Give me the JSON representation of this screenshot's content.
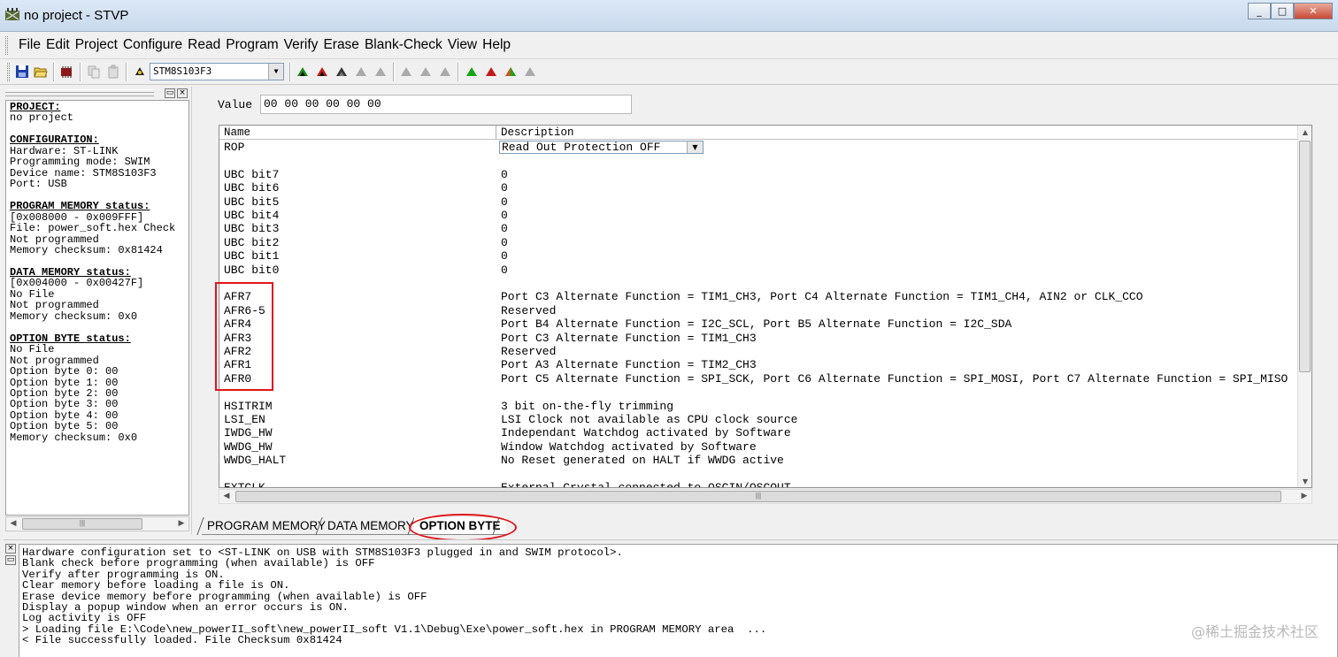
{
  "window": {
    "title": "no project - STVP",
    "min": "_",
    "max": "□",
    "close": "✕"
  },
  "menu": [
    {
      "label": "File"
    },
    {
      "label": "Edit"
    },
    {
      "label": "Project"
    },
    {
      "label": "Configure"
    },
    {
      "label": "Read"
    },
    {
      "label": "Program"
    },
    {
      "label": "Verify"
    },
    {
      "label": "Erase"
    },
    {
      "label": "Blank-Check"
    },
    {
      "label": "View"
    },
    {
      "label": "Help"
    }
  ],
  "toolbar": {
    "device": "STM8S103F3"
  },
  "left_panel": {
    "project_heading": "PROJECT:",
    "project_value": "no project",
    "config_heading": "CONFIGURATION:",
    "config_lines": [
      "Hardware: ST-LINK",
      "Programming mode: SWIM",
      "Device name: STM8S103F3",
      "Port: USB"
    ],
    "program_heading": "PROGRAM MEMORY status:",
    "program_lines": [
      "[0x008000 - 0x009FFF]",
      "File: power_soft.hex Check",
      "Not programmed",
      "Memory checksum: 0x81424"
    ],
    "data_heading": "DATA MEMORY status:",
    "data_lines": [
      "[0x004000 - 0x00427F]",
      "No File",
      "Not programmed",
      "Memory checksum: 0x0"
    ],
    "option_heading": "OPTION BYTE status:",
    "option_lines": [
      "No File",
      "Not programmed",
      "Option byte 0: 00",
      "Option byte 1: 00",
      "Option byte 2: 00",
      "Option byte 3: 00",
      "Option byte 4: 00",
      "Option byte 5: 00",
      "Memory checksum: 0x0"
    ]
  },
  "value_field": {
    "label": "Value",
    "value": "00 00 00 00 00 00"
  },
  "grid": {
    "col_name": "Name",
    "col_desc": "Description",
    "rop": {
      "name": "ROP",
      "desc": "Read Out Protection OFF"
    },
    "rows": [
      {
        "name": "UBC bit7",
        "desc": "0"
      },
      {
        "name": "UBC bit6",
        "desc": "0"
      },
      {
        "name": "UBC bit5",
        "desc": "0"
      },
      {
        "name": "UBC bit4",
        "desc": "0"
      },
      {
        "name": "UBC bit3",
        "desc": "0"
      },
      {
        "name": "UBC bit2",
        "desc": "0"
      },
      {
        "name": "UBC bit1",
        "desc": "0"
      },
      {
        "name": "UBC bit0",
        "desc": "0"
      },
      {
        "name": "",
        "desc": ""
      },
      {
        "name": "AFR7",
        "desc": "Port C3 Alternate Function = TIM1_CH3, Port C4 Alternate Function = TIM1_CH4, AIN2 or CLK_CCO"
      },
      {
        "name": "AFR6-5",
        "desc": "Reserved"
      },
      {
        "name": "AFR4",
        "desc": "Port B4 Alternate Function = I2C_SCL, Port B5 Alternate Function = I2C_SDA"
      },
      {
        "name": "AFR3",
        "desc": "Port C3 Alternate Function = TIM1_CH3"
      },
      {
        "name": "AFR2",
        "desc": "Reserved"
      },
      {
        "name": "AFR1",
        "desc": "Port A3 Alternate Function = TIM2_CH3"
      },
      {
        "name": "AFR0",
        "desc": "Port C5 Alternate Function = SPI_SCK, Port C6 Alternate Function = SPI_MOSI, Port C7 Alternate Function = SPI_MISO"
      },
      {
        "name": "",
        "desc": ""
      },
      {
        "name": "HSITRIM",
        "desc": "3 bit on-the-fly trimming"
      },
      {
        "name": "LSI_EN",
        "desc": "LSI Clock not available as CPU clock source"
      },
      {
        "name": "IWDG_HW",
        "desc": "Independant Watchdog activated by Software"
      },
      {
        "name": "WWDG_HW",
        "desc": "Window Watchdog activated by Software"
      },
      {
        "name": "WWDG_HALT",
        "desc": "No Reset generated on HALT if WWDG active"
      },
      {
        "name": "",
        "desc": ""
      },
      {
        "name": "EXTCLK",
        "desc": "External Crystal connected to OSCIN/OSCOUT"
      }
    ]
  },
  "tabs": [
    {
      "label": "PROGRAM MEMORY"
    },
    {
      "label": "DATA MEMORY"
    },
    {
      "label": "OPTION BYTE"
    }
  ],
  "log": [
    "Hardware configuration set to <ST-LINK on USB with STM8S103F3 plugged in and SWIM protocol>.",
    "Blank check before programming (when available) is OFF",
    "Verify after programming is ON.",
    "Clear memory before loading a file is ON.",
    "Erase device memory before programming (when available) is OFF",
    "Display a popup window when an error occurs is ON.",
    "Log activity is OFF",
    "> Loading file E:\\Code\\new_powerII_soft\\new_powerII_soft V1.1\\Debug\\Exe\\power_soft.hex in PROGRAM MEMORY area  ...",
    "< File successfully loaded. File Checksum 0x81424"
  ],
  "watermark": "@稀土掘金技术社区"
}
